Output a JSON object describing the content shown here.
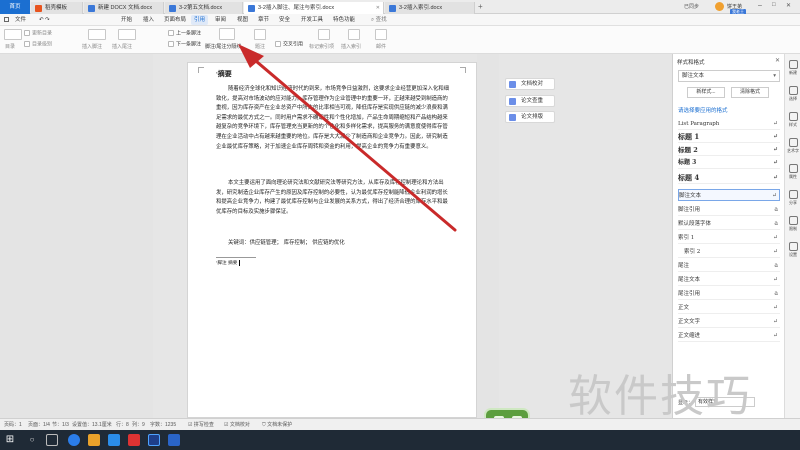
{
  "tabs": {
    "home": "首页",
    "items": [
      {
        "label": "稻壳模板",
        "color": "#e8541e"
      },
      {
        "label": "新建 DOCX 文档.docx",
        "color": "#3b78d8"
      },
      {
        "label": "3-2第五文档.docx",
        "color": "#3b78d8"
      },
      {
        "label": "3-2插入脚注、尾注与索引.docx",
        "color": "#3b78d8"
      },
      {
        "label": "3-2插入索引.docx",
        "color": "#3b78d8"
      }
    ],
    "right_status": "已同步",
    "user_name": "饼王弟",
    "user_badge": "我老王"
  },
  "menu": {
    "items": [
      "文件",
      "开始",
      "插入",
      "页面布局",
      "引用",
      "审阅",
      "视图",
      "章节",
      "安全",
      "开发工具",
      "特色功能"
    ],
    "active_index": 4,
    "search": "查找"
  },
  "ribbon": {
    "toc": "目录",
    "update_toc": "更新目录",
    "toc_level": "目录级别",
    "insert_footnote": "插入脚注",
    "insert_endnote": "插入尾注",
    "prev_footnote": "上一条脚注",
    "next_footnote": "下一条脚注",
    "footnote_separator": "脚注/尾注分隔线",
    "caption": "题注",
    "cross_ref": "交叉引用",
    "mark_entry": "标记索引项",
    "insert_index": "插入索引",
    "mail": "邮件"
  },
  "float_tools": [
    "文档校对",
    "论文查重",
    "论文排版"
  ],
  "document": {
    "title": "摘要",
    "para1": "随着经济全球化和知识经济时代的到来，市场竞争日益激烈，这要求企业经营更加深入化和细致化，提高对市场波动的应对能力。库存管理作为企业管理中的重要一环，正越来越受到制造商的重视，因为库存资产在企业总资产中所占的比率相当可观，降低库存是实现供应链的减少浪费和满足需求的最优方式之一。同时用户需求不确定性和个性化增加，产品生命周期缩短和产品结构越来越复杂的竞争环境下，库存管理充当更新的的个性化和多样化需求，提高服务的满意度使得库存管理在企业活动中占有越来越重要的地位。库存是大大减少了制造商和企业竞争力。因此，研究制造企业最优库存策略，对于加速企业库存周转和资金的利用，提高企业的竞争力有重要意义。",
    "para2": "本文主要运用了面向理论研究法和文献研究法等研究方法，从库存及库存控制理论和方法出发，研究制造企业库存产生的原因及库存控制的必要性，认为最优库存控制能降低企业利润的增长和提高企业竞争力，构建了最优库存控制与企业发展的关系方式，得出了经济合理的库存水平和最优库存的目标及实施步骤保证。",
    "keywords": "关键词：供应链管理； 库存控制； 供应链的优化",
    "footnote_marker": "¹",
    "footnote_text": "脚注 摘要"
  },
  "style_pane": {
    "title": "样式和格式",
    "current_style": "脚注文本",
    "btn_new": "新样式...",
    "btn_clear": "清除格式",
    "hint": "请选择要应用的格式",
    "styles": [
      "List Paragraph",
      "标题 1",
      "标题 2",
      "标题 3",
      "标题 4",
      "脚注文本",
      "脚注引用",
      "默认段落字体",
      "索引 1",
      "索引 2",
      "尾注",
      "尾注文本",
      "尾注引用",
      "正文",
      "正文文字",
      "正文缩进"
    ],
    "show_label": "显示：",
    "show_value": "有效样式"
  },
  "icon_bar": [
    "新建",
    "选择",
    "样式",
    "艺术字",
    "属性",
    "分享",
    "限制",
    "设置"
  ],
  "status_bar": {
    "page": "页码：1",
    "pages": "页面：1/4",
    "section": "节：1/3",
    "settings": "设置值：13.1厘米",
    "row": "行：8",
    "col": "列：9",
    "words": "字数：1235",
    "spell": "拼写检查",
    "proof": "文档校对",
    "protect": "文档未保护"
  },
  "watermark": "软件技巧"
}
